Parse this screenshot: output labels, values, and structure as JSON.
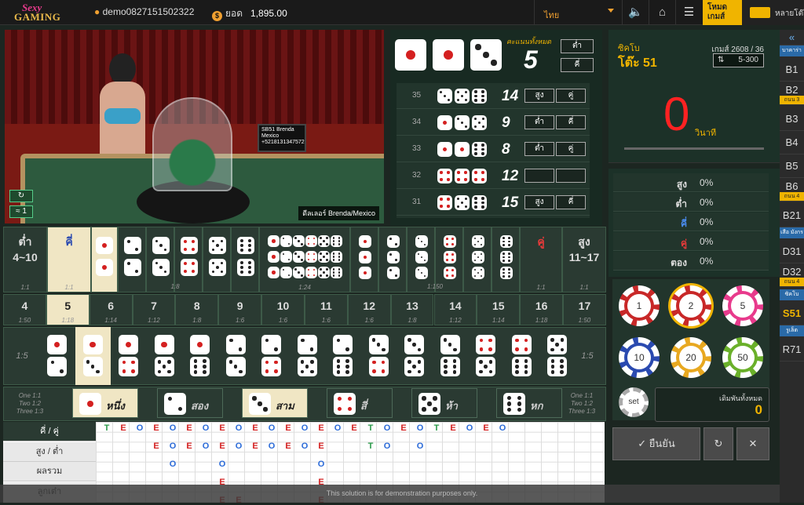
{
  "topbar": {
    "logo_top": "Sexy",
    "logo_bottom": "GAMING",
    "username": "demo0827151502322",
    "balance_label": "ยอด",
    "balance_value": "1,895.00",
    "language": "ไทย",
    "mode_label": "โหมดเกมส์",
    "lobby_label": "หลายโต๊ะ"
  },
  "video": {
    "screen_text": "SB51 Brenda Mexico +5218131347572",
    "dealer_label": "ดีลเลอร์ Brenda/Mexico",
    "signal_value": "1"
  },
  "result": {
    "total_caption": "คะแนนทั้งหมด",
    "total": "5",
    "tags": [
      "ต่ำ",
      "คี่"
    ]
  },
  "history": [
    {
      "round": "35",
      "sum": "14",
      "tags": [
        "สูง",
        "คู่"
      ]
    },
    {
      "round": "34",
      "sum": "9",
      "tags": [
        "ต่ำ",
        "คี่"
      ]
    },
    {
      "round": "33",
      "sum": "8",
      "tags": [
        "ต่ำ",
        "คู่"
      ]
    },
    {
      "round": "32",
      "sum": "12",
      "tags": [
        "",
        ""
      ]
    },
    {
      "round": "31",
      "sum": "15",
      "tags": [
        "สูง",
        "คี่"
      ]
    }
  ],
  "board": {
    "row1": [
      {
        "label": "ต่ำ",
        "sub": "4~10",
        "odds": "1:1"
      },
      {
        "label": "คี่",
        "sub": "",
        "odds": "1:1"
      },
      {
        "label": "คู่",
        "sub": "",
        "odds": "1:1"
      },
      {
        "label": "สูง",
        "sub": "11~17",
        "odds": "1:1"
      }
    ],
    "row1_odds": [
      "1:8",
      "1:24",
      "1:150"
    ],
    "sums": [
      {
        "n": "4",
        "o": "1:50"
      },
      {
        "n": "5",
        "o": "1:18"
      },
      {
        "n": "6",
        "o": "1:14"
      },
      {
        "n": "7",
        "o": "1:12"
      },
      {
        "n": "8",
        "o": "1:8"
      },
      {
        "n": "9",
        "o": "1:6"
      },
      {
        "n": "10",
        "o": "1:6"
      },
      {
        "n": "11",
        "o": "1:6"
      },
      {
        "n": "12",
        "o": "1:6"
      },
      {
        "n": "13",
        "o": "1:8"
      },
      {
        "n": "14",
        "o": "1:12"
      },
      {
        "n": "15",
        "o": "1:14"
      },
      {
        "n": "16",
        "o": "1:18"
      },
      {
        "n": "17",
        "o": "1:50"
      }
    ],
    "pair_odds": "1:5",
    "singles": [
      "หนึ่ง",
      "สอง",
      "สาม",
      "สี่",
      "ห้า",
      "หก"
    ],
    "single_odds": [
      "One 1:1",
      "Two 1:2",
      "Three 1:3"
    ]
  },
  "road": {
    "labels": [
      "คี่ / คู่",
      "สูง / ต่ำ",
      "ผลรวม",
      "ลูกเต๋า"
    ],
    "row1": [
      "T",
      "E",
      "O",
      "E",
      "O",
      "E",
      "O",
      "E",
      "O",
      "E",
      "O",
      "E",
      "O",
      "E",
      "O",
      "E",
      "T",
      "O",
      "E",
      "O",
      "T",
      "E",
      "O",
      "E",
      "O"
    ],
    "row2": [
      "",
      "",
      "",
      "E",
      "O",
      "E",
      "O",
      "E",
      "O",
      "E",
      "O",
      "E",
      "O",
      "E",
      "",
      "",
      "T",
      "O",
      "",
      "O",
      "",
      "",
      "",
      "",
      ""
    ],
    "row3": [
      "",
      "",
      "",
      "",
      "O",
      "",
      "",
      "O",
      "",
      "",
      "",
      "",
      "",
      "O"
    ],
    "row4": [
      "",
      "",
      "",
      "",
      "",
      "",
      "",
      "E",
      "",
      "",
      "",
      "",
      "",
      "E"
    ],
    "row5": [
      "",
      "",
      "",
      "",
      "",
      "",
      "",
      "E",
      "E",
      "",
      "",
      "",
      "",
      "E"
    ],
    "disclaimer": "This solution is for demonstration purposes only."
  },
  "table_info": {
    "type_label": "ซิคโบ",
    "table_name": "โต๊ะ 51",
    "game_no": "เกมส์ 2608 / 36",
    "limit": "5-300",
    "countdown": "0",
    "seconds_label": "วินาที"
  },
  "stats": [
    {
      "k": "สูง",
      "v": "0%",
      "color": "#dddddd"
    },
    {
      "k": "ต่ำ",
      "v": "0%",
      "color": "#dddddd"
    },
    {
      "k": "คี่",
      "v": "0%",
      "color": "#4a8cf0"
    },
    {
      "k": "คู่",
      "v": "0%",
      "color": "#e83a3a"
    },
    {
      "k": "ตอง",
      "v": "0%",
      "color": "#dddddd"
    }
  ],
  "chips": [
    {
      "v": "1",
      "c": "#c82828"
    },
    {
      "v": "2",
      "c": "#c82828"
    },
    {
      "v": "5",
      "c": "#e83a8c"
    },
    {
      "v": "10",
      "c": "#2a4ab0"
    },
    {
      "v": "20",
      "c": "#e8a820"
    },
    {
      "v": "50",
      "c": "#6ab02a"
    }
  ],
  "set_label": "set",
  "total_bet": {
    "label": "เดิมพันทั้งหมด",
    "value": "0"
  },
  "actions": {
    "confirm": "ยืนยัน"
  },
  "sidebar": [
    {
      "t": "head",
      "l": "บาคาร่า"
    },
    {
      "t": "item",
      "l": "B1"
    },
    {
      "t": "item",
      "l": "B2",
      "b": "ถนน 3"
    },
    {
      "t": "item",
      "l": "B3"
    },
    {
      "t": "item",
      "l": "B4"
    },
    {
      "t": "item",
      "l": "B5"
    },
    {
      "t": "item",
      "l": "B6",
      "b": "ถนน 4"
    },
    {
      "t": "item",
      "l": "B21"
    },
    {
      "t": "head",
      "l": "เสือ มังกร"
    },
    {
      "t": "item",
      "l": "D31"
    },
    {
      "t": "item",
      "l": "D32",
      "b": "ถนน 4"
    },
    {
      "t": "head",
      "l": "ซิคโบ"
    },
    {
      "t": "item",
      "l": "S51",
      "a": true
    },
    {
      "t": "head",
      "l": "รูเล็ต"
    },
    {
      "t": "item",
      "l": "R71"
    }
  ],
  "colors": {
    "accent": "#f0b400",
    "red": "#d42020",
    "blue": "#2a4ab0",
    "felt": "#2a3a32"
  }
}
